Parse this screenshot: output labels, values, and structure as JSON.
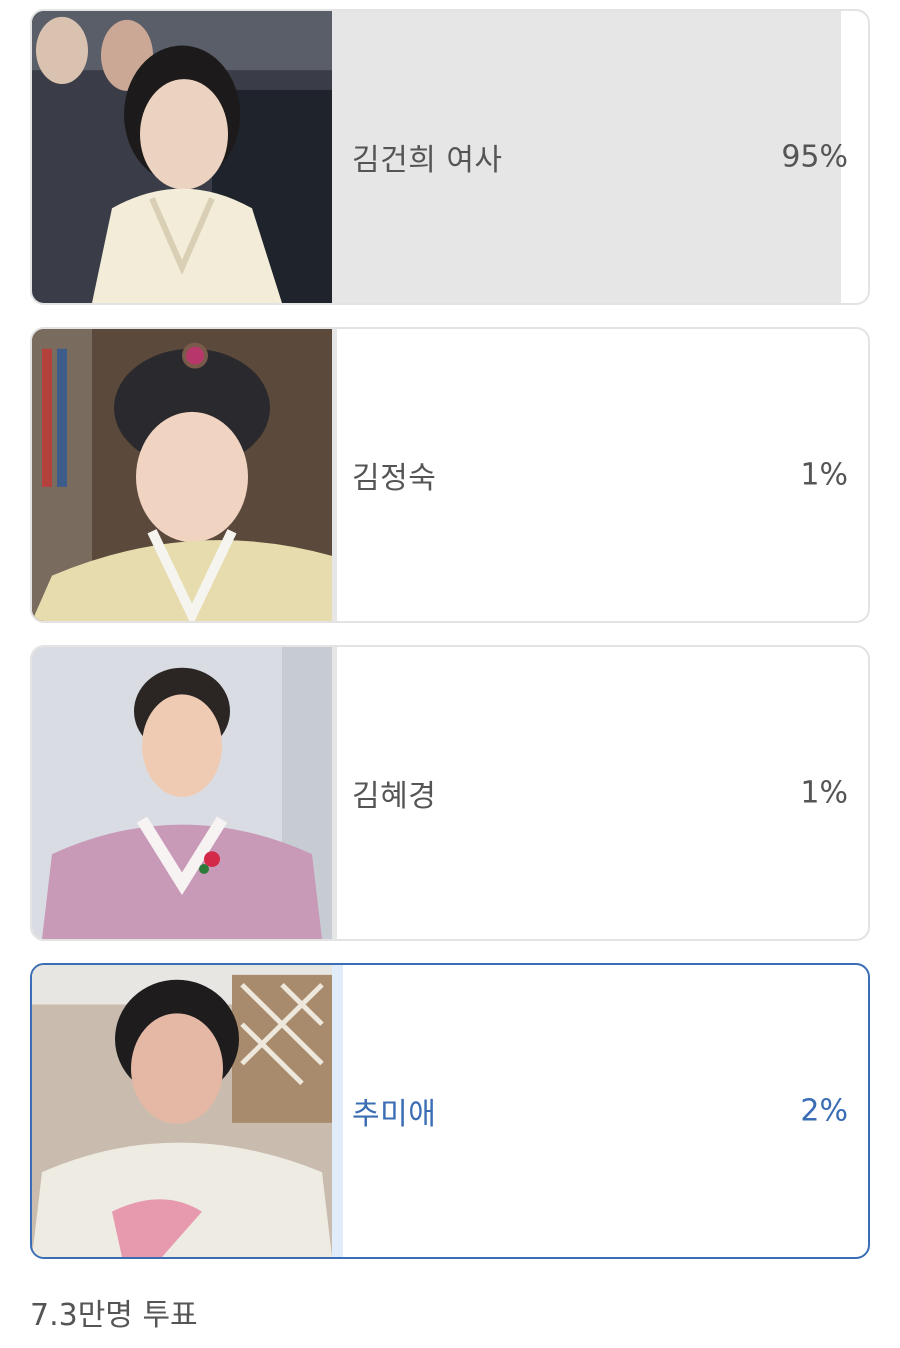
{
  "poll": {
    "options": [
      {
        "label": "김건희 여사",
        "percent_text": "95%",
        "percent": 95,
        "selected": false
      },
      {
        "label": "김정숙",
        "percent_text": "1%",
        "percent": 1,
        "selected": false
      },
      {
        "label": "김혜경",
        "percent_text": "1%",
        "percent": 1,
        "selected": false
      },
      {
        "label": "추미애",
        "percent_text": "2%",
        "percent": 2,
        "selected": true
      }
    ],
    "total_votes": "7.3만명 투표"
  },
  "colors": {
    "selected_accent": "#3a6db4",
    "bar_fill": "#e6e6e6",
    "selected_bar_fill": "#e1ecfa",
    "text": "#555555"
  }
}
